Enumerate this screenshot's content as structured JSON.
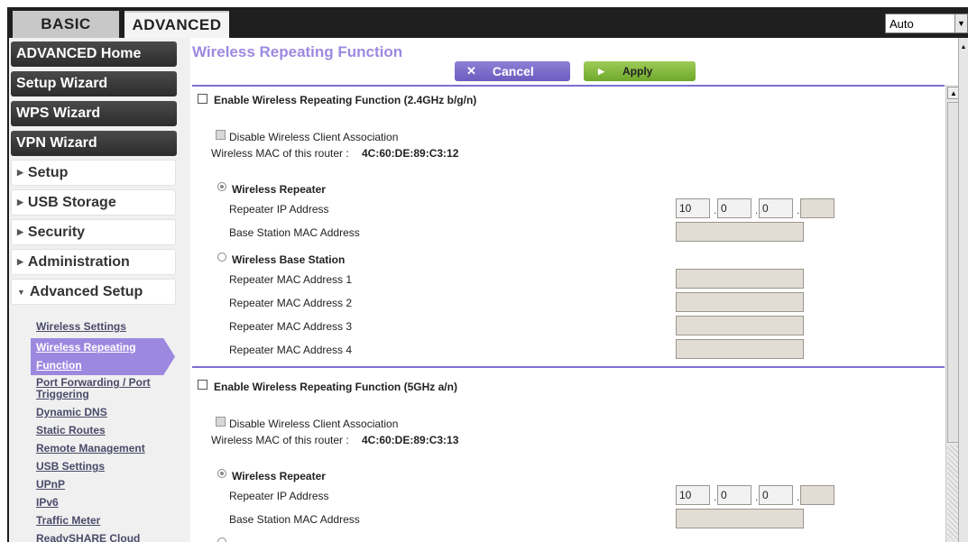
{
  "tabs": {
    "basic": "BASIC",
    "advanced": "ADVANCED"
  },
  "language_select": {
    "value": "Auto"
  },
  "sidebar": {
    "primary": [
      "ADVANCED Home",
      "Setup Wizard",
      "WPS Wizard",
      "VPN Wizard"
    ],
    "sections": [
      {
        "label": "Setup",
        "expanded": false
      },
      {
        "label": "USB Storage",
        "expanded": false
      },
      {
        "label": "Security",
        "expanded": false
      },
      {
        "label": "Administration",
        "expanded": false
      },
      {
        "label": "Advanced Setup",
        "expanded": true
      }
    ],
    "subitems": [
      "Wireless Settings",
      "Wireless Repeating",
      "Function",
      "Port Forwarding / Port",
      "Triggering",
      "Dynamic DNS",
      "Static Routes",
      "Remote Management",
      "USB Settings",
      "UPnP",
      "IPv6",
      "Traffic Meter",
      "ReadySHARE Cloud"
    ]
  },
  "main": {
    "title": "Wireless Repeating Function",
    "cancel_label": "Cancel",
    "apply_label": "Apply",
    "band1": {
      "enable_label": "Enable Wireless Repeating Function (2.4GHz b/g/n)",
      "disable_client_label": "Disable Wireless Client Association",
      "mac_label": "Wireless MAC of this router : ",
      "mac_value": "4C:60:DE:89:C3:12",
      "repeater_label": "Wireless Repeater",
      "repeater_ip_label": "Repeater IP Address",
      "ip": [
        "10",
        "0",
        "0",
        ""
      ],
      "base_mac_label": "Base Station MAC Address",
      "base_station_label": "Wireless Base Station",
      "repeater_macs": [
        "Repeater MAC Address 1",
        "Repeater MAC Address 2",
        "Repeater MAC Address 3",
        "Repeater MAC Address 4"
      ]
    },
    "band2": {
      "enable_label": "Enable Wireless Repeating Function (5GHz a/n)",
      "disable_client_label": "Disable Wireless Client Association",
      "mac_label": "Wireless MAC of this router : ",
      "mac_value": "4C:60:DE:89:C3:13",
      "repeater_label": "Wireless Repeater",
      "repeater_ip_label": "Repeater IP Address",
      "ip": [
        "10",
        "0",
        "0",
        ""
      ],
      "base_mac_label": "Base Station MAC Address"
    }
  }
}
